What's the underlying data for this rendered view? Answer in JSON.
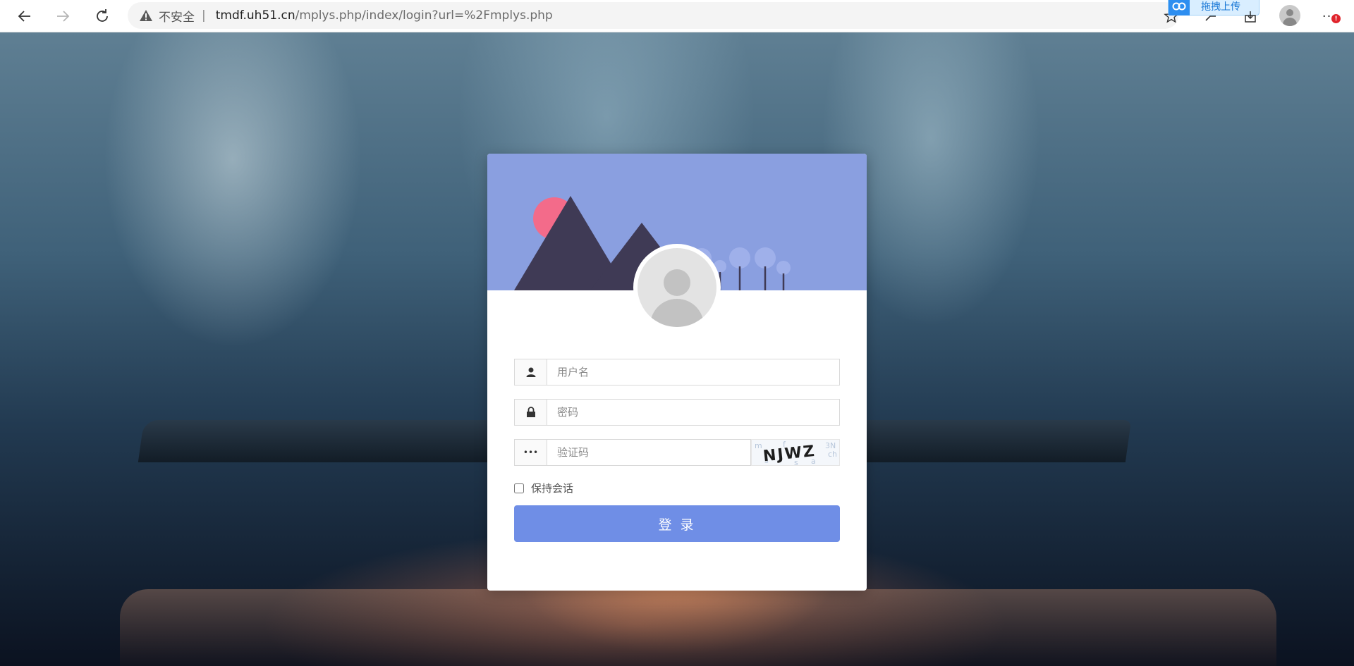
{
  "browser": {
    "security_label": "不安全",
    "separator": "|",
    "url_host": "tmdf.uh51.cn",
    "url_path": "/mplys.php/index/login?url=%2Fmplys.php",
    "extension_label": "拖拽上传",
    "alert_badge": "!"
  },
  "login": {
    "username_placeholder": "用户名",
    "password_placeholder": "密码",
    "captcha_placeholder": "验证码",
    "captcha_addon": "•••",
    "captcha_text": "NJWZ",
    "remember_label": "保持会话",
    "submit_label": "登 录"
  },
  "colors": {
    "banner": "#8a9fe0",
    "mountain": "#3f3a55",
    "sun": "#f36b8a",
    "button": "#6f8ee6"
  },
  "icons": [
    "back-arrow-icon",
    "forward-arrow-icon",
    "reload-icon",
    "warning-icon",
    "favorite-star-icon",
    "user-icon",
    "lock-icon",
    "profile-icon",
    "more-icon"
  ]
}
